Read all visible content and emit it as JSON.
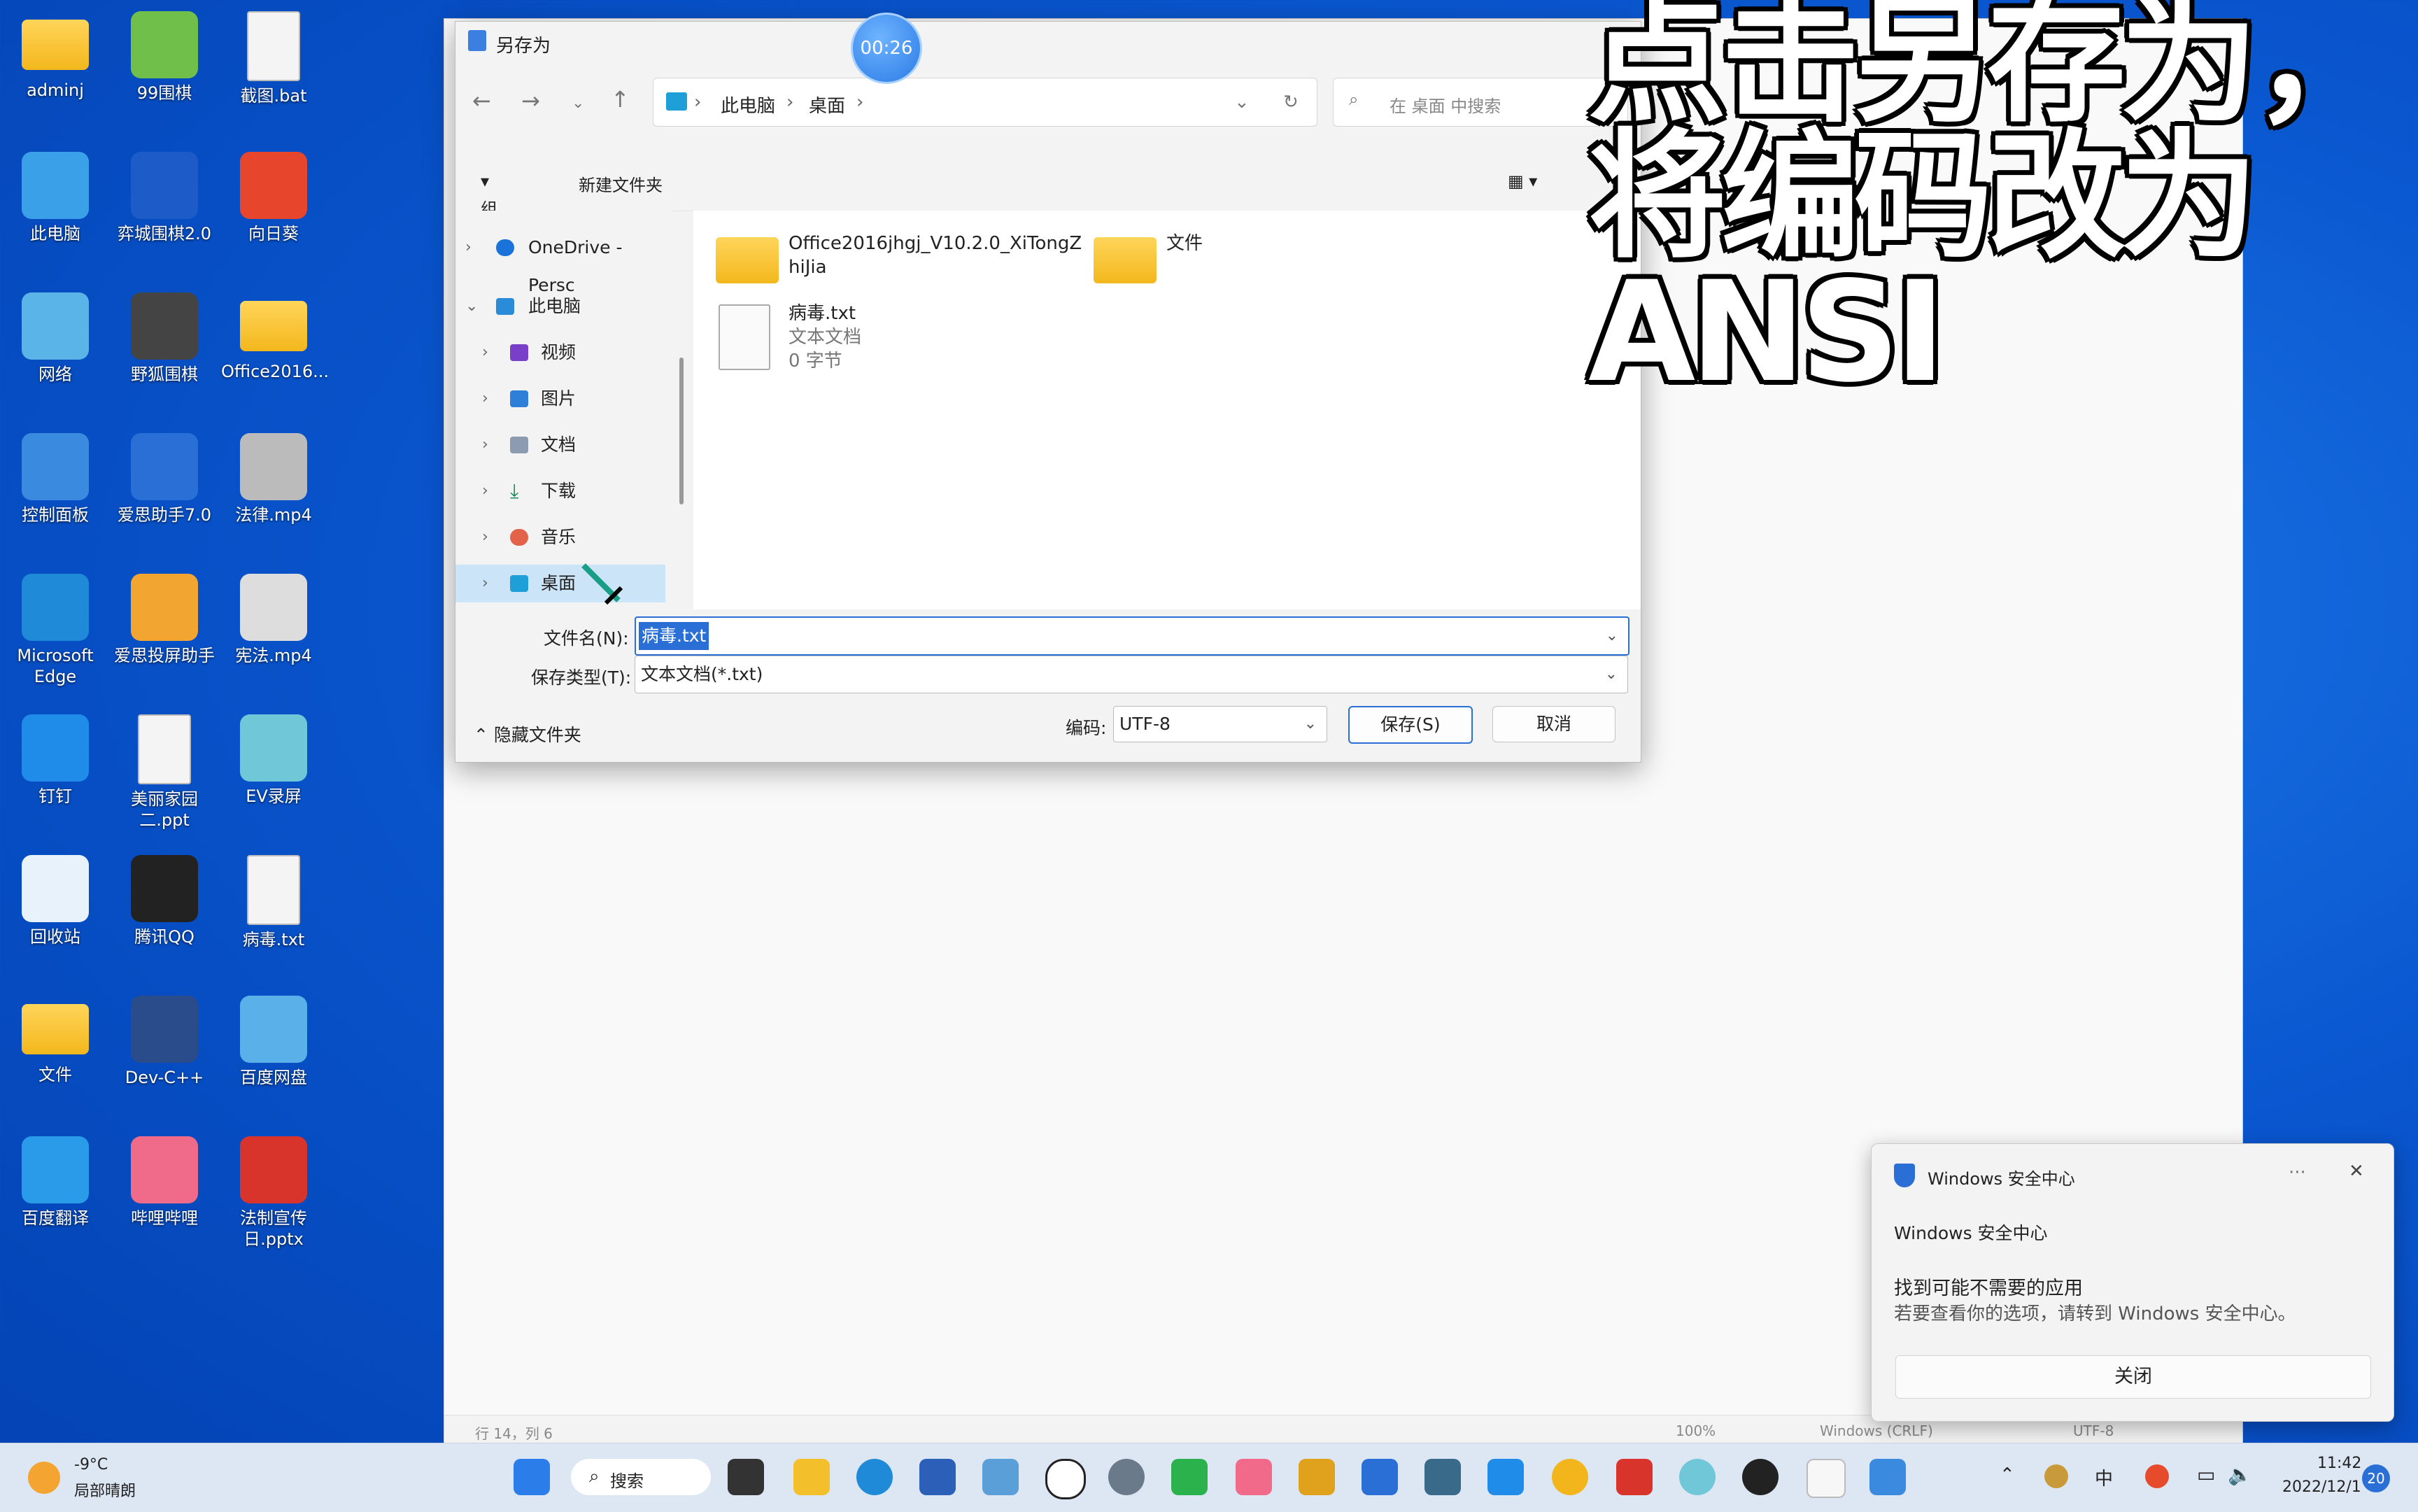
{
  "desktop": {
    "icons": [
      {
        "label": "adminj"
      },
      {
        "label": "99围棋"
      },
      {
        "label": "截图.bat"
      },
      {
        "label": "此电脑"
      },
      {
        "label": "弈城围棋2.0"
      },
      {
        "label": "向日葵"
      },
      {
        "label": "网络"
      },
      {
        "label": "野狐围棋"
      },
      {
        "label": "Office2016..."
      },
      {
        "label": "控制面板"
      },
      {
        "label": "爱思助手7.0"
      },
      {
        "label": "法律.mp4"
      },
      {
        "label": "Microsoft Edge"
      },
      {
        "label": "爱思投屏助手"
      },
      {
        "label": "宪法.mp4"
      },
      {
        "label": "钉钉"
      },
      {
        "label": "美丽家园二.ppt"
      },
      {
        "label": "EV录屏"
      },
      {
        "label": "回收站"
      },
      {
        "label": "腾讯QQ"
      },
      {
        "label": "病毒.txt"
      },
      {
        "label": "文件"
      },
      {
        "label": "Dev-C++"
      },
      {
        "label": "百度网盘"
      },
      {
        "label": "百度翻译"
      },
      {
        "label": "哔哩哔哩"
      },
      {
        "label": "法制宣传日.pptx"
      }
    ]
  },
  "timer": "00:26",
  "caption": "点击另存为，将编码改为ANSI",
  "dialog": {
    "title": "另存为",
    "breadcrumb": [
      "此电脑",
      "桌面"
    ],
    "search_placeholder": "在 桌面 中搜索",
    "toolbar": {
      "organize": "组织",
      "new_folder": "新建文件夹"
    },
    "nav": [
      {
        "label": "OneDrive - Persc"
      },
      {
        "label": "此电脑"
      },
      {
        "label": "视频"
      },
      {
        "label": "图片"
      },
      {
        "label": "文档"
      },
      {
        "label": "下载"
      },
      {
        "label": "音乐"
      },
      {
        "label": "桌面"
      }
    ],
    "files": [
      {
        "name_line1": "Office2016jhgj_V10.2.0_XiTongZ",
        "name_line2": "hiJia"
      },
      {
        "name": "文件"
      },
      {
        "name": "病毒.txt",
        "type": "文本文档",
        "size": "0 字节"
      }
    ],
    "filename_label": "文件名(N):",
    "filename_value": "病毒.txt",
    "filetype_label": "保存类型(T):",
    "filetype_value": "文本文档(*.txt)",
    "hide_folders": "隐藏文件夹",
    "encoding_label": "编码:",
    "encoding_value": "UTF-8",
    "save": "保存(S)",
    "cancel": "取消"
  },
  "notepad_status": {
    "pos": "行 14，列 6",
    "zoom": "100%",
    "eol": "Windows (CRLF)",
    "enc": "UTF-8"
  },
  "toast": {
    "app": "Windows 安全中心",
    "more": "···",
    "heading": "Windows 安全中心",
    "title": "找到可能不需要的应用",
    "body": "若要查看你的选项，请转到 Windows 安全中心。",
    "close": "关闭"
  },
  "taskbar": {
    "weather_temp": "-9°C",
    "weather_desc": "局部晴朗",
    "search": "搜索",
    "ime": "中",
    "time": "11:42",
    "date": "2022/12/1",
    "notif_count": "20"
  },
  "colors": {
    "accent": "#2a6fd6",
    "selection": "#cce4f7",
    "desktop": "#0a57d0"
  }
}
